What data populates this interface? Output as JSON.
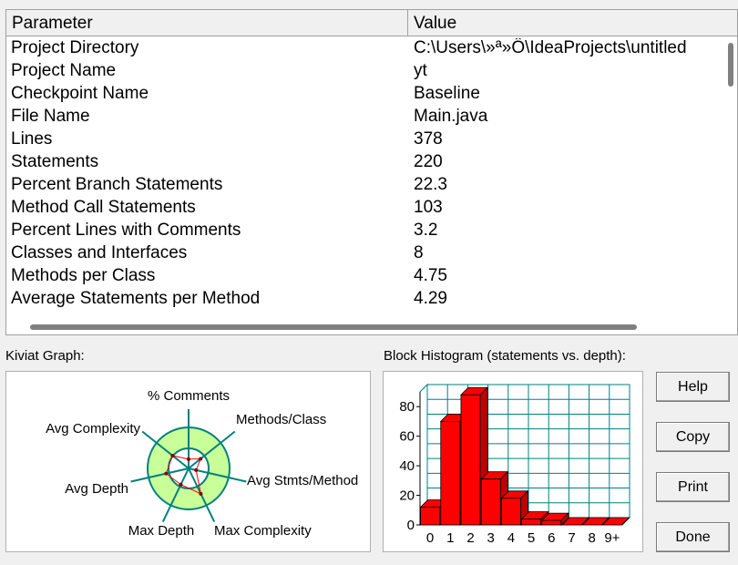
{
  "table": {
    "columns": [
      "Parameter",
      "Value"
    ],
    "rows": [
      {
        "parameter": "Project Directory",
        "value": "C:\\Users\\»ª»Ô\\IdeaProjects\\untitled"
      },
      {
        "parameter": "Project Name",
        "value": "yt"
      },
      {
        "parameter": "Checkpoint Name",
        "value": "Baseline"
      },
      {
        "parameter": "File Name",
        "value": "Main.java"
      },
      {
        "parameter": "Lines",
        "value": "378"
      },
      {
        "parameter": "Statements",
        "value": "220"
      },
      {
        "parameter": "Percent Branch Statements",
        "value": "22.3"
      },
      {
        "parameter": "Method Call Statements",
        "value": "103"
      },
      {
        "parameter": "Percent Lines with Comments",
        "value": "3.2"
      },
      {
        "parameter": "Classes and Interfaces",
        "value": "8"
      },
      {
        "parameter": "Methods per Class",
        "value": "4.75"
      },
      {
        "parameter": "Average Statements per Method",
        "value": "4.29"
      }
    ]
  },
  "kiviat": {
    "label": "Kiviat Graph:",
    "axes": [
      "% Comments",
      "Methods/Class",
      "Avg Stmts/Method",
      "Max Complexity",
      "Max Depth",
      "Avg Depth",
      "Avg Complexity"
    ],
    "colors": {
      "ring": "#c8ff98",
      "axis": "#008080",
      "polygon": "#ff0000"
    }
  },
  "chart_data": {
    "type": "bar",
    "title": "Block Histogram (statements vs. depth):",
    "categories": [
      "0",
      "1",
      "2",
      "3",
      "4",
      "5",
      "6",
      "7",
      "8",
      "9+"
    ],
    "values": [
      12,
      70,
      88,
      31,
      18,
      4,
      3,
      0,
      0,
      0
    ],
    "ylim": [
      0,
      90
    ],
    "yticks": [
      0,
      20,
      40,
      60,
      80
    ],
    "grid": true,
    "bar_color": "#ff0000",
    "grid_color": "#008080"
  },
  "buttons": {
    "help": "Help",
    "copy": "Copy",
    "print": "Print",
    "done": "Done"
  }
}
